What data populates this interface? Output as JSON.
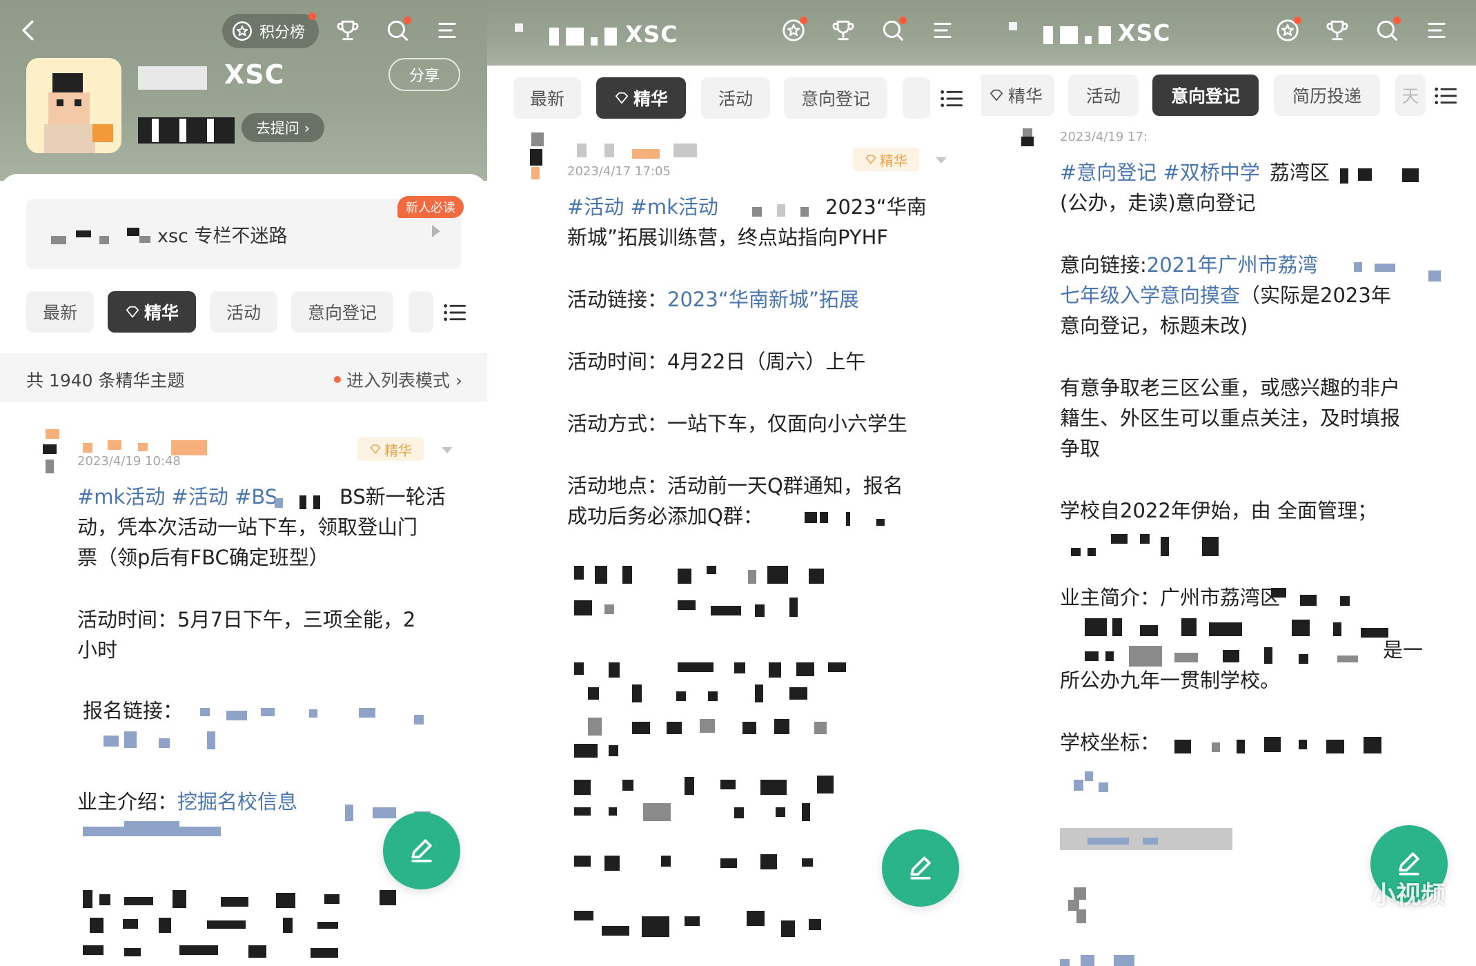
{
  "panel1": {
    "ranking_label": "积分榜",
    "nickname": "XSC",
    "ask_label": "去提问 ›",
    "share_label": "分享",
    "column_text": "xsc 专栏不迷路",
    "new_badge": "新人必读",
    "tabs": [
      "最新",
      "精华",
      "活动",
      "意向登记"
    ],
    "count_text": "共 1940 条精华主题",
    "list_mode_label": "进入列表模式 ›",
    "post": {
      "time": "2023/4/19 10:48",
      "badge": "精华",
      "l1_tags": "#mk活动 #活动 #BS",
      "l1_text": "BS新一轮活",
      "l2": "动，凭本次活动一站下车，领取登山门",
      "l3": "票（领p后有FBC确定班型）",
      "l4": "活动时间：5月7日下午，三项全能，2",
      "l5": "小时",
      "l6": "报名链接：",
      "l7_label": "业主介绍：",
      "l7_link": "挖掘名校信息"
    }
  },
  "panel2": {
    "title": "XSC",
    "tabs": [
      "最新",
      "精华",
      "活动",
      "意向登记"
    ],
    "post": {
      "time": "2023/4/17 17:05",
      "badge": "精华",
      "l1_tags": "#活动 #mk活动",
      "l1_text": "2023“华南",
      "l2": "新城”拓展训练营，终点站指向PYHF",
      "l3_label": "活动链接：",
      "l3_link": "2023“华南新城”拓展",
      "l4": "活动时间：4月22日（周六）上午",
      "l5": "活动方式：一站下车，仅面向小六学生",
      "l6": "活动地点：活动前一天Q群通知，报名",
      "l7": "成功后务必添加Q群："
    }
  },
  "panel3": {
    "title": "XSC",
    "tabs": [
      "精华",
      "活动",
      "意向登记",
      "简历投递",
      "天"
    ],
    "post": {
      "time": "2023/4/19 17:",
      "l1_tags": "#意向登记 #双桥中学",
      "l1_text": "荔湾区",
      "l2": "(公办，走读)意向登记",
      "l3_label": "意向链接:",
      "l3_link": "2021年广州市荔湾",
      "l4_link": "七年级入学意向摸查",
      "l4_text": "（实际是2023年",
      "l5": "意向登记，标题未改)",
      "l6": "有意争取老三区公重，或感兴趣的非户",
      "l7": "籍生、外区生可以重点关注，及时填报",
      "l8": "争取",
      "l9": "学校自2022年伊始，由      全面管理；",
      "l10": "业主简介：广州市荔湾区",
      "l11": "是一",
      "l12": "所公办九年一贯制学校。",
      "l13": "学校坐标：",
      "watermark": "小视频"
    }
  },
  "colors": {
    "header_green": "#9aa493",
    "accent_teal": "#2bb48a",
    "link_blue": "#4a76b0",
    "badge_orange": "#f26a3f",
    "essence_gold": "#e6a24a"
  }
}
